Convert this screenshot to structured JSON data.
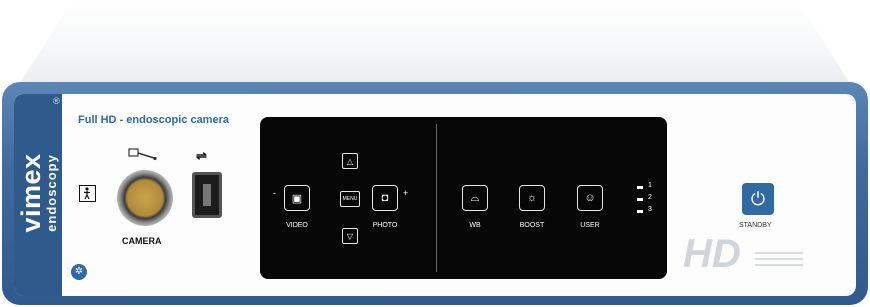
{
  "device": {
    "brand": "vimex",
    "brand_sub": "endoscopy",
    "registered": "®",
    "title": "Full HD - endoscopic camera",
    "camera_label": "CAMERA",
    "panel": {
      "video_label": "VIDEO",
      "photo_label": "PHOTO",
      "menu_label": "MENU",
      "minus": "-",
      "plus": "+",
      "wb_label": "WB",
      "boost_label": "BOOST",
      "user_label": "USER",
      "led_1": "1",
      "led_2": "2",
      "led_3": "3"
    },
    "standby_label": "STANDBY",
    "hd_mark": "HD"
  },
  "colors": {
    "frame": "#3e6a9c",
    "accent": "#2f6aa3",
    "panel": "#070707"
  },
  "icons": [
    "patient-icon",
    "endoscope-icon",
    "usb-icon",
    "video-icon",
    "photo-camera-icon",
    "arrow-up-icon",
    "arrow-down-icon",
    "white-balance-icon",
    "brightness-icon",
    "user-icon",
    "power-icon",
    "brand-logo-icon"
  ]
}
